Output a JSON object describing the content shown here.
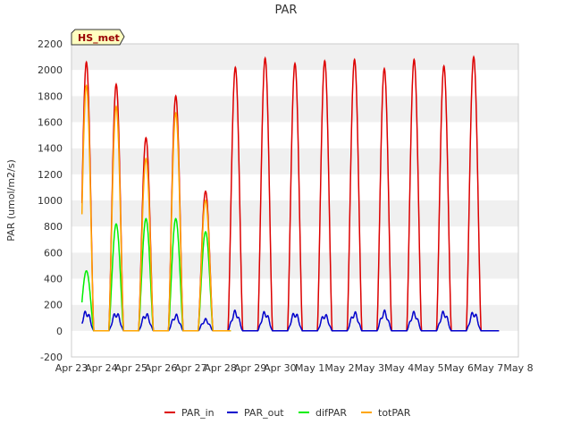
{
  "chart_data": {
    "type": "line",
    "title": "PAR",
    "ylabel": "PAR (umol/m2/s)",
    "xlabel": "",
    "site_label": "HS_met",
    "ylim": [
      -200,
      2200
    ],
    "yticks": [
      -200,
      0,
      200,
      400,
      600,
      800,
      1000,
      1200,
      1400,
      1600,
      1800,
      2000,
      2200
    ],
    "xlim": [
      0,
      15
    ],
    "xtick_labels": [
      "Apr 23",
      "Apr 24",
      "Apr 25",
      "Apr 26",
      "Apr 27",
      "Apr 28",
      "Apr 29",
      "Apr 30",
      "May 1",
      "May 2",
      "May 3",
      "May 4",
      "May 5",
      "May 6",
      "May 7",
      "May 8"
    ],
    "grid": "horizontal bands",
    "legend_position": "bottom",
    "series": [
      {
        "name": "PAR_in",
        "color": "#dd0000",
        "day_start": 0.35,
        "daily_peaks": [
          2060,
          1890,
          1480,
          1800,
          1070,
          2020,
          2090,
          2050,
          2070,
          2080,
          2010,
          2080,
          2030,
          2100
        ]
      },
      {
        "name": "PAR_out",
        "color": "#0000cc",
        "day_start": 0.35,
        "daily_peaks": [
          160,
          150,
          140,
          130,
          95,
          160,
          155,
          150,
          135,
          150,
          160,
          150,
          155,
          155
        ]
      },
      {
        "name": "difPAR",
        "color": "#00ee00",
        "day_start": 0.35,
        "daily_peaks": [
          460,
          820,
          860,
          860,
          760
        ]
      },
      {
        "name": "totPAR",
        "color": "#ffa500",
        "day_start": 0.35,
        "daily_peaks": [
          1880,
          1720,
          1320,
          1670,
          1000
        ]
      }
    ]
  }
}
